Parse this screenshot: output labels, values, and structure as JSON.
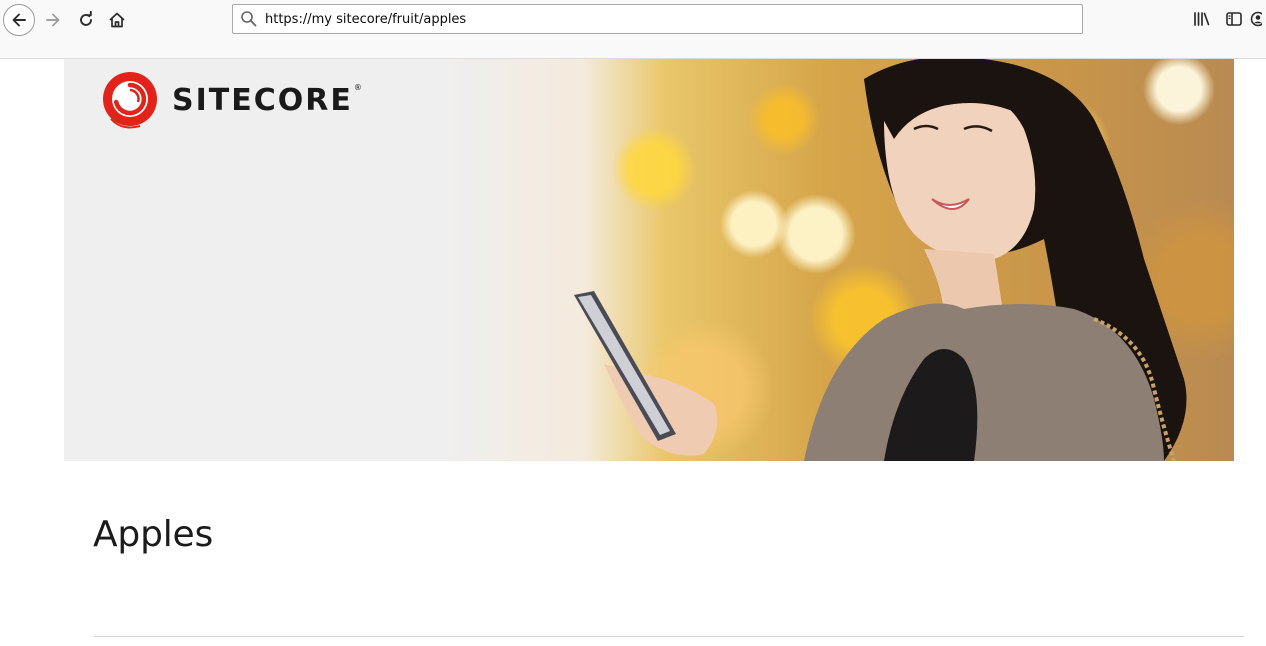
{
  "browser": {
    "url": "https://my sitecore/fruit/apples",
    "icons": {
      "back": "arrow-left-icon",
      "forward": "arrow-right-icon",
      "reload": "reload-icon",
      "home": "home-icon",
      "search": "search-icon",
      "library": "library-icon",
      "sidebar": "sidebar-icon",
      "account": "account-icon"
    }
  },
  "banner": {
    "logo_text": "SITECORE",
    "logo_mark": "®",
    "colors": {
      "logo_red": "#e2231a",
      "logo_text": "#1a1a1a"
    }
  },
  "page": {
    "title": "Apples"
  }
}
